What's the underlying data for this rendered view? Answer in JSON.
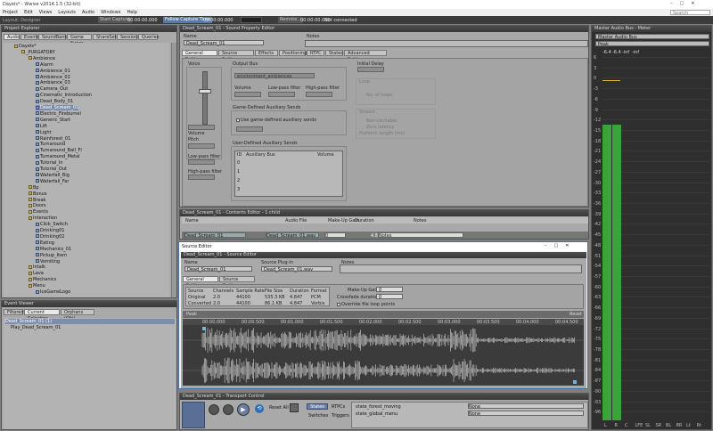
{
  "app": {
    "title": "Dayels* - Wwise v2014.1.5 (32-bit)",
    "menu": [
      "Project",
      "Edit",
      "Views",
      "Layouts",
      "Audio",
      "Windows",
      "Help"
    ],
    "search_placeholder": "Search"
  },
  "toolbar": {
    "items": [
      "Start Capture",
      "00:00:00.000",
      "Follow Capture Time",
      "00:00:00.000",
      "Remote...",
      "00:00:00.000",
      "Not connected"
    ],
    "layout_label": "Layout: Designer"
  },
  "project_explorer": {
    "title": "Project Explorer",
    "tabs": [
      "Audio",
      "Events",
      "SoundBanks",
      "Game Syncs",
      "ShareSets",
      "Sessions",
      "Queries"
    ],
    "tree": [
      {
        "label": "Dayels*",
        "depth": 0
      },
      {
        "label": "_PURGATORY",
        "depth": 1
      },
      {
        "label": "Ambience",
        "depth": 2
      },
      {
        "label": "Alarm",
        "depth": 3
      },
      {
        "label": "Ambience_01",
        "depth": 3
      },
      {
        "label": "Ambience_02",
        "depth": 3
      },
      {
        "label": "Ambience_03",
        "depth": 3
      },
      {
        "label": "Camera_Out",
        "depth": 3
      },
      {
        "label": "Cinematic_Introduction",
        "depth": 3
      },
      {
        "label": "Dead_Body_01",
        "depth": 3
      },
      {
        "label": "Dead_Scream_01",
        "depth": 3
      },
      {
        "label": "Electric_Fireburnel",
        "depth": 3
      },
      {
        "label": "Generic_Start",
        "depth": 3
      },
      {
        "label": "Lift",
        "depth": 3
      },
      {
        "label": "Light",
        "depth": 3
      },
      {
        "label": "Rainforest_01",
        "depth": 3
      },
      {
        "label": "Turnaround",
        "depth": 3
      },
      {
        "label": "Turnaround_Ball_Fl",
        "depth": 3
      },
      {
        "label": "Turnaround_Metal",
        "depth": 3
      },
      {
        "label": "Tutorial_In",
        "depth": 3
      },
      {
        "label": "Tutorial_Out",
        "depth": 3
      },
      {
        "label": "Waterfall_Big",
        "depth": 3
      },
      {
        "label": "Waterfall_Far",
        "depth": 3
      },
      {
        "label": "Bp",
        "depth": 2
      },
      {
        "label": "Bonus",
        "depth": 2
      },
      {
        "label": "Break",
        "depth": 2
      },
      {
        "label": "Doors",
        "depth": 2
      },
      {
        "label": "Events",
        "depth": 2
      },
      {
        "label": "Interaction",
        "depth": 2
      },
      {
        "label": "Click_Switch",
        "depth": 3
      },
      {
        "label": "Drinking01",
        "depth": 3
      },
      {
        "label": "Drinking02",
        "depth": 3
      },
      {
        "label": "Eating",
        "depth": 3
      },
      {
        "label": "Mechanics_01",
        "depth": 3
      },
      {
        "label": "Pickup_Item",
        "depth": 3
      },
      {
        "label": "Vomiting",
        "depth": 3
      },
      {
        "label": "Intalk",
        "depth": 2
      },
      {
        "label": "Lava",
        "depth": 2
      },
      {
        "label": "Mechanics",
        "depth": 2
      },
      {
        "label": "Menu",
        "depth": 2
      },
      {
        "label": "IceGameLogo",
        "depth": 3
      }
    ]
  },
  "event_viewer": {
    "title": "Event Viewer",
    "tabs": [
      "Filtered",
      "Current Selection",
      "Orphans (Obj)"
    ],
    "items": [
      "Dead_Scream_01 (1)",
      "Play_Dead_Scream_01"
    ]
  },
  "sound_property_editor": {
    "title": "Dead_Scream_01 - Sound Property Editor",
    "name_label": "Name",
    "name_value": "Dead_Scream_01",
    "notes_label": "Notes",
    "tabs": [
      "General Settings",
      "Source Settings",
      "Effects",
      "Positioning",
      "RTPC",
      "States",
      "Advanced Settings"
    ],
    "voice_label": "Voice",
    "volume_label": "Volume",
    "pitch_label": "Pitch",
    "lowpass_label": "Low-pass filter",
    "highpass_label": "High-pass filter",
    "output_bus_label": "Output Bus",
    "output_bus_value": "environment_ambiences",
    "bus_volume": "Volume",
    "bus_lowpass": "Low-pass filter",
    "bus_highpass": "High-pass filter",
    "game_aux_label": "Game-Defined Auxiliary Sends",
    "use_game_aux": "Use game-defined auxiliary sends",
    "user_aux_label": "User-Defined Auxiliary Sends",
    "aux_columns": [
      "ID",
      "Auxiliary Bus",
      "Volume"
    ],
    "aux_rows": [
      "0",
      "1",
      "2",
      "3"
    ],
    "initial_delay_label": "Initial Delay",
    "loop_label": "Loop",
    "no_of_loops": "No. of loops",
    "stream_label": "Stream",
    "non_cachable": "Non-cachable",
    "zero_latency": "Zero latency",
    "prefetch_label": "Prefetch length (ms)"
  },
  "contents_editor": {
    "title": "Dead_Scream_01 - Contents Editor - 1 child",
    "columns": [
      "Name",
      "Audio File",
      "Make-Up Gain",
      "Duration",
      "Notes"
    ],
    "row": {
      "name": "Dead_Scream_01",
      "file": "Dead_Scream_01.wav",
      "gain": "0",
      "duration": "4.847",
      "notes": "Notes"
    }
  },
  "source_editor": {
    "window_title": "Source Editor",
    "title": "Dead_Scream_01 - Source Editor",
    "name_label": "Name",
    "name_value": "Dead_Scream_01",
    "plugin_label": "Source Plug-in",
    "plugin_value": "Dead_Scream_01.wav",
    "notes_label": "Notes",
    "tabs": [
      "General Settings",
      "Source Settings"
    ],
    "columns": [
      "Source",
      "Channels",
      "Sample Rate",
      "File Size",
      "Duration",
      "Format"
    ],
    "rows": [
      [
        "Original",
        "2.0",
        "44100",
        "535.3 KB",
        "4.847",
        "PCM"
      ],
      [
        "Converted",
        "2.0",
        "44100",
        "86.1 KB",
        "4.847",
        "Vorbis"
      ]
    ],
    "makeup_gain_label": "Make-Up Gain",
    "makeup_gain_value": "0",
    "crossfade_label": "Crossfade duration",
    "crossfade_value": "0",
    "override_loop": "Override file loop points",
    "reset_label": "Reset",
    "ruler": [
      "00:00.000",
      "00:00.500",
      "00:01.000",
      "00:01.500",
      "00:02.000",
      "00:02.500",
      "00:03.000",
      "00:03.500",
      "00:04.000",
      "00:04.500"
    ]
  },
  "transport": {
    "title": "Dead_Scream_01 - Transport Control",
    "reset_all": "Reset All",
    "states": "States",
    "rtpcs": "RTPCs",
    "switches": "Switches",
    "triggers": "Triggers",
    "state_rows": [
      "state_forest_moving",
      "state_global_menu"
    ],
    "state_values": [
      "None",
      "None"
    ]
  },
  "meter": {
    "title": "Master Audio Bus - Meter",
    "bus": "Master Audio Bus",
    "mode": "Peak",
    "top_values": [
      "-6.4",
      "-6.4",
      "-inf",
      "-inf"
    ],
    "scale": [
      "6",
      "3",
      "0",
      "-3",
      "-6",
      "-9",
      "-12",
      "-15",
      "-18",
      "-21",
      "-24",
      "-27",
      "-30",
      "-33",
      "-36",
      "-39",
      "-42",
      "-45",
      "-48",
      "-51",
      "-54",
      "-57",
      "-60",
      "-63",
      "-66",
      "-69",
      "-72",
      "-75",
      "-78",
      "-81",
      "-84",
      "-87",
      "-90",
      "-93",
      "-96"
    ],
    "channels": [
      "L",
      "R",
      "C",
      "LFE",
      "SL",
      "SR",
      "BL",
      "BR",
      "Lt",
      "Rt"
    ],
    "levels": [
      -13.5,
      -13.5
    ],
    "level_unit": "dB"
  },
  "colors": {
    "accent": "#6a7ea3",
    "meter": "#3aa33a",
    "dark": "#3c3c3c"
  }
}
